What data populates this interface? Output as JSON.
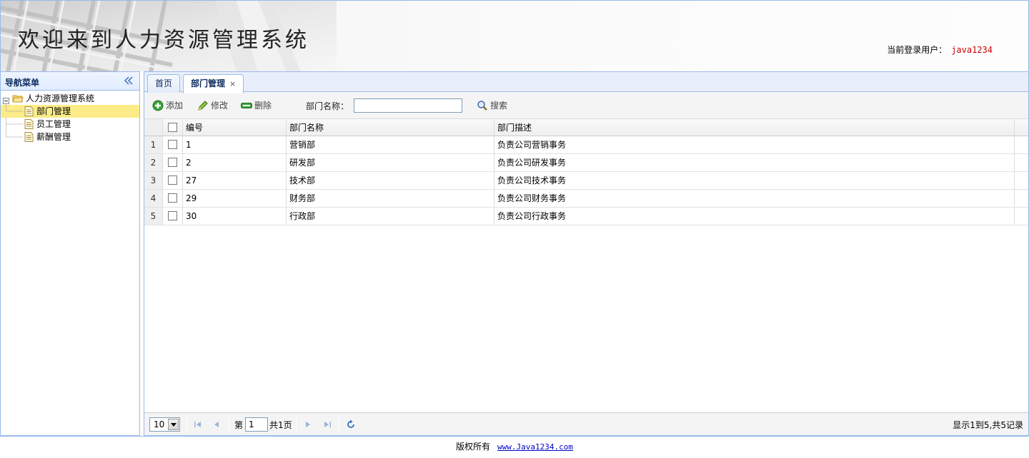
{
  "header": {
    "title": "欢迎来到人力资源管理系统",
    "login_label": "当前登录用户：",
    "login_user": "java1234"
  },
  "nav": {
    "title": "导航菜单",
    "collapse_icon": "double-chevron-left-icon",
    "root": {
      "label": "人力资源管理系统",
      "icon": "folder-open-icon"
    },
    "items": [
      {
        "label": "部门管理",
        "icon": "file-icon",
        "selected": true
      },
      {
        "label": "员工管理",
        "icon": "file-icon",
        "selected": false
      },
      {
        "label": "薪酬管理",
        "icon": "file-icon",
        "selected": false
      }
    ]
  },
  "tabs": [
    {
      "label": "首页",
      "active": false,
      "closable": false
    },
    {
      "label": "部门管理",
      "active": true,
      "closable": true,
      "close_glyph": "×"
    }
  ],
  "toolbar": {
    "add_label": "添加",
    "edit_label": "修改",
    "delete_label": "删除",
    "search_label": "部门名称：",
    "search_value": "",
    "search_button": "搜索"
  },
  "grid": {
    "columns": [
      "编号",
      "部门名称",
      "部门描述"
    ],
    "rows": [
      {
        "n": "1",
        "id": "1",
        "name": "营销部",
        "desc": "负责公司营销事务"
      },
      {
        "n": "2",
        "id": "2",
        "name": "研发部",
        "desc": "负责公司研发事务"
      },
      {
        "n": "3",
        "id": "27",
        "name": "技术部",
        "desc": "负责公司技术事务"
      },
      {
        "n": "4",
        "id": "29",
        "name": "财务部",
        "desc": "负责公司财务事务"
      },
      {
        "n": "5",
        "id": "30",
        "name": "行政部",
        "desc": "负责公司行政事务"
      }
    ]
  },
  "pager": {
    "page_size": "10",
    "page_prefix": "第",
    "page_value": "1",
    "page_total": "共1页",
    "info": "显示1到5,共5记录"
  },
  "footer": {
    "copyright": "版权所有",
    "link": "www.Java1234.com"
  },
  "colors": {
    "border": "#99bbe8",
    "selected_node": "#fbec88",
    "user_text": "#cc0000",
    "link": "#0000cc"
  }
}
